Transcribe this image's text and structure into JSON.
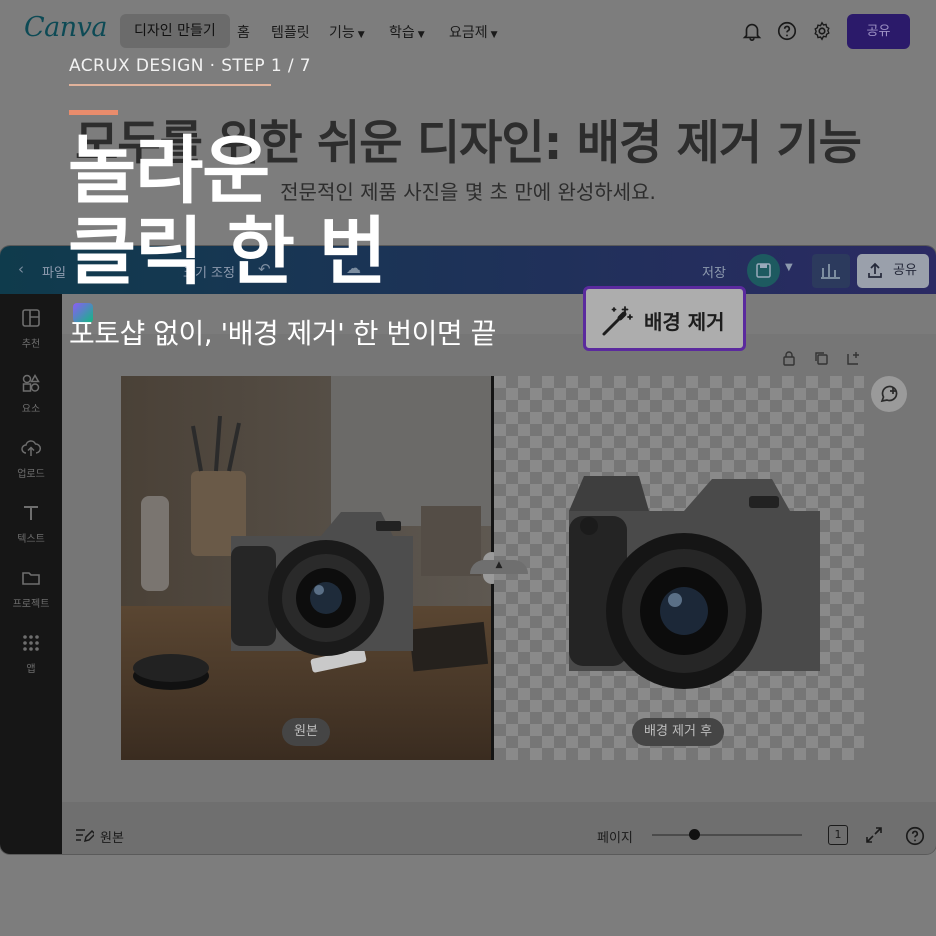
{
  "site": {
    "logo": "Canva",
    "nav": {
      "create_design": "디자인 만들기",
      "home": "홈",
      "templates": "템플릿",
      "features": "기능",
      "learn": "학습",
      "pricing": "요금제"
    },
    "share_label": "공유",
    "icons": [
      "bell-icon",
      "help-icon",
      "gear-icon"
    ]
  },
  "hero": {
    "title": "모두를 위한 쉬운 디자인: 배경 제거 기능",
    "subtitle": "전문적인 제품 사진을 몇 초 만에 완성하세요."
  },
  "overlay": {
    "step": "ACRUX DESIGN · STEP 1 / 7",
    "headline_line1": "놀라운",
    "headline_line2": "클릭 한 번",
    "tagline": "포토샵 없이, '배경 제거' 한 번이면 끝",
    "callout": "배경 제거"
  },
  "editor": {
    "toolbar": {
      "file": "파일",
      "resize": "크기 조정",
      "save": "저장",
      "share": "공유"
    },
    "sidebar": [
      {
        "label": "추천",
        "icon": "layout-icon"
      },
      {
        "label": "요소",
        "icon": "shapes-icon"
      },
      {
        "label": "업로드",
        "icon": "upload-cloud-icon"
      },
      {
        "label": "텍스트",
        "icon": "text-icon"
      },
      {
        "label": "프로젝트",
        "icon": "folder-icon"
      },
      {
        "label": "앱",
        "icon": "apps-grid-icon"
      }
    ],
    "canvas": {
      "original_tag": "원본",
      "after_tag": "배경 제거 후"
    },
    "footer": {
      "notes": "원본",
      "page": "페이지",
      "page_count": "1",
      "zoom_fraction": 0.28
    }
  },
  "colors": {
    "accent_orange": "#e98c6c",
    "callout_border": "#5b2a9e",
    "share_button": "#2b1a6a"
  }
}
